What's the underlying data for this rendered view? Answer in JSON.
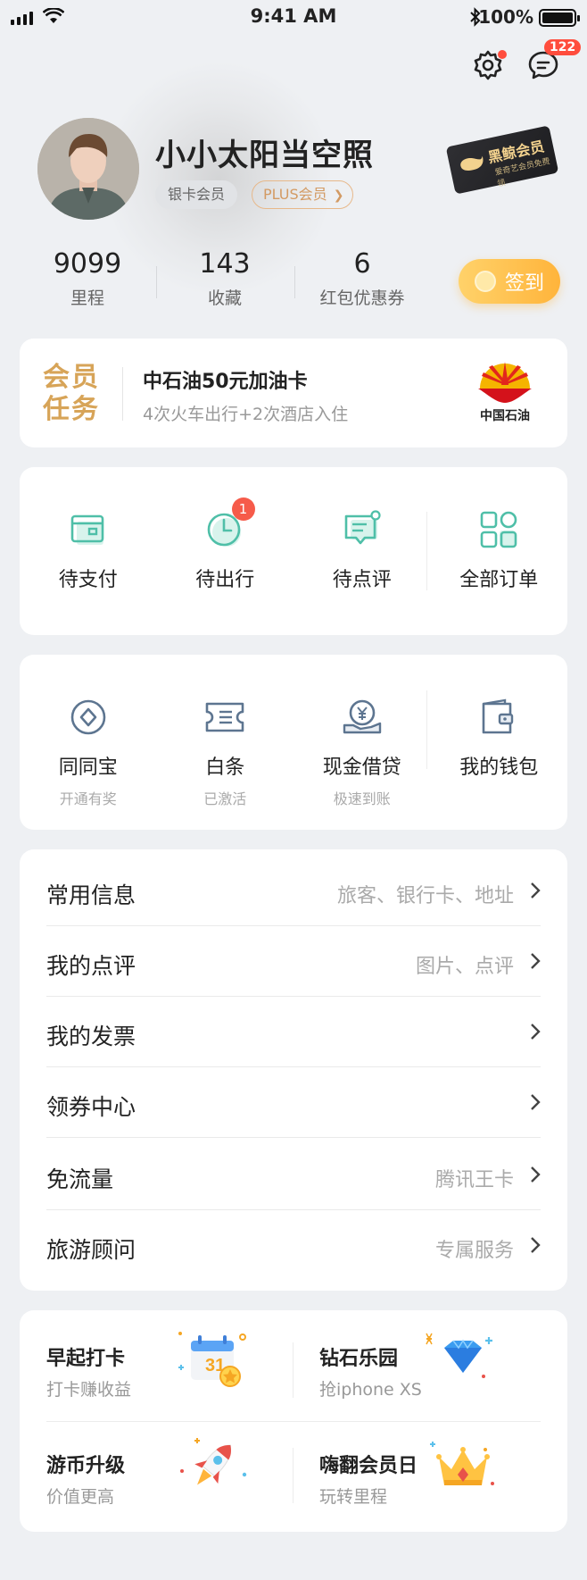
{
  "status_bar": {
    "time": "9:41 AM",
    "battery": "100%"
  },
  "header": {
    "message_count": "122",
    "username": "小小太阳当空照",
    "tags": [
      "银卡会员",
      "PLUS会员"
    ],
    "whale_card": {
      "title": "黑鲸会员",
      "sub": "爱奇艺会员免费领"
    },
    "stats": [
      {
        "value": "9099",
        "label": "里程"
      },
      {
        "value": "143",
        "label": "收藏"
      },
      {
        "value": "6",
        "label": "红包优惠券"
      }
    ],
    "signin_label": "签到"
  },
  "member_task": {
    "title": "会员任务",
    "headline": "中石油50元加油卡",
    "detail": "4次火车出行+2次酒店入住",
    "logo_text": "中国石油"
  },
  "orders": [
    {
      "label": "待支付",
      "icon": "wallet-icon"
    },
    {
      "label": "待出行",
      "icon": "clock-icon",
      "badge": "1"
    },
    {
      "label": "待点评",
      "icon": "comment-icon"
    },
    {
      "label": "全部订单",
      "icon": "grid-icon"
    }
  ],
  "finance": [
    {
      "label": "同同宝",
      "sub": "开通有奖",
      "icon": "diamond-coin-icon"
    },
    {
      "label": "白条",
      "sub": "已激活",
      "icon": "ticket-icon"
    },
    {
      "label": "现金借贷",
      "sub": "极速到账",
      "icon": "yuan-hand-icon"
    },
    {
      "label": "我的钱包",
      "sub": "",
      "icon": "wallet-icon"
    }
  ],
  "menu": [
    {
      "label": "常用信息",
      "value": "旅客、银行卡、地址"
    },
    {
      "label": "我的点评",
      "value": "图片、点评"
    },
    {
      "label": "我的发票",
      "value": ""
    },
    {
      "label": "领券中心",
      "value": ""
    },
    {
      "label": "免流量",
      "value": "腾讯王卡"
    },
    {
      "label": "旅游顾问",
      "value": "专属服务"
    }
  ],
  "promos": [
    {
      "title": "早起打卡",
      "sub": "打卡赚收益",
      "icon": "calendar-icon",
      "calendar_day": "31"
    },
    {
      "title": "钻石乐园",
      "sub": "抢iphone XS",
      "icon": "diamond-icon"
    },
    {
      "title": "游币升级",
      "sub": "价值更高",
      "icon": "rocket-icon"
    },
    {
      "title": "嗨翻会员日",
      "sub": "玩转里程",
      "icon": "crown-icon"
    }
  ],
  "colors": {
    "accent": "#4fbfa8",
    "gold": "#d7a458",
    "badge_red": "#f65b4a",
    "signin": "#ffb43b"
  }
}
